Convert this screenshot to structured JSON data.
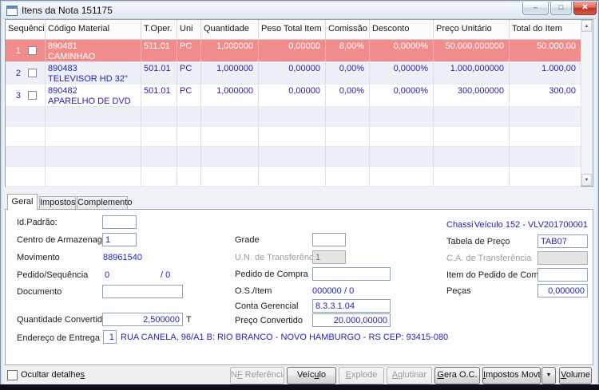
{
  "window": {
    "title": "Itens da Nota 151175",
    "controls": {
      "minimize": "‒",
      "maximize": "□",
      "close": "✕"
    }
  },
  "grid": {
    "columns": [
      "Sequência",
      "Código Material",
      "T.Oper.",
      "Uni",
      "Quantidade",
      "Peso Total Item",
      "Comissão",
      "Desconto",
      "Preço Unitário",
      "Total do Item"
    ],
    "scrollbar": {
      "up": "▲",
      "down": "▼"
    },
    "rows": [
      {
        "seq": "1",
        "code": "890481",
        "desc": "CAMINHAO",
        "oper": "511.01",
        "uni": "PC",
        "qty": "1,000000",
        "weight": "0,00000",
        "commission": "8,00%",
        "discount": "0,0000%",
        "unit_price": "50.000,000000",
        "total": "50.000,00"
      },
      {
        "seq": "2",
        "code": "890483",
        "desc": "TELEVISOR HD 32\"",
        "oper": "501.01",
        "uni": "PC",
        "qty": "1,000000",
        "weight": "0,00000",
        "commission": "0,00%",
        "discount": "0,0000%",
        "unit_price": "1.000,000000",
        "total": "1.000,00"
      },
      {
        "seq": "3",
        "code": "890482",
        "desc": "APARELHO DE DVD",
        "oper": "501.01",
        "uni": "PC",
        "qty": "1,000000",
        "weight": "0,00000",
        "commission": "0,00%",
        "discount": "0,0000%",
        "unit_price": "300,000000",
        "total": "300,00"
      }
    ]
  },
  "tabs": {
    "geral": "Geral",
    "impostos": "Impostos",
    "complemento": "Complemento"
  },
  "form": {
    "labels": {
      "id_padrao": "Id.Padrão:",
      "centro": "Centro de Armazenagem",
      "movimento": "Movimento",
      "pedido_seq": "Pedido/Sequência",
      "documento": "Documento",
      "qtd_conv": "Quantidade Convertida",
      "endereco": "Endereço de Entrega",
      "grade": "Grade",
      "un_transf": "U.N. de Transferência",
      "ped_compra": "Pedido de Compra",
      "os_item": "O.S./Item",
      "conta": "Conta Gerencial",
      "preco_conv": "Preço Convertido",
      "chassi": "Chassi",
      "tabela": "Tabela de Preço",
      "ca_transf": "C.A. de Transferência",
      "item_ped": "Item do Pedido de Compra",
      "pecas": "Peças"
    },
    "values": {
      "centro": "1",
      "movimento": "88961540",
      "pedido": "0",
      "pedido_seq": "/ 0",
      "un_transf": "1",
      "os": "000000",
      "os_item": "/ 0",
      "conta": "8.3.3.1.04",
      "qtd_conv": "2,500000",
      "qtd_unit": "T",
      "preco_conv": "20.000,00000",
      "endereco_num": "1",
      "endereco": "RUA CANELA, 96/A1 B: RIO BRANCO - NOVO HAMBURGO - RS CEP: 93415-080",
      "chassi": "Veículo 152 - VLV201700001",
      "tabela": "TAB07",
      "pecas": "0,000000"
    }
  },
  "footer": {
    "hide_details": {
      "pre": "Ocultar detalhe",
      "u": "s",
      "post": ""
    },
    "buttons": {
      "nf": {
        "pre": "N",
        "u": "F",
        "post": " Referência"
      },
      "veiculo": {
        "pre": "Veíc",
        "u": "u",
        "post": "lo"
      },
      "explode": {
        "pre": "",
        "u": "E",
        "post": "xplode"
      },
      "aglutinar": {
        "pre": "",
        "u": "A",
        "post": "glutinar"
      },
      "gera": {
        "pre": "",
        "u": "G",
        "post": "era O.C."
      },
      "impostos": {
        "pre": "",
        "u": "I",
        "post": "mpostos Movto"
      },
      "dropdown": "▼",
      "volume": {
        "pre": "",
        "u": "V",
        "post": "olume"
      }
    }
  },
  "colors": {
    "selected_row": "#f28b8b",
    "row_alt": "#eef0f7",
    "value_blue": "#2525b0",
    "titlebar": "#e9eef4",
    "dark_strip": "#0e0e18"
  }
}
